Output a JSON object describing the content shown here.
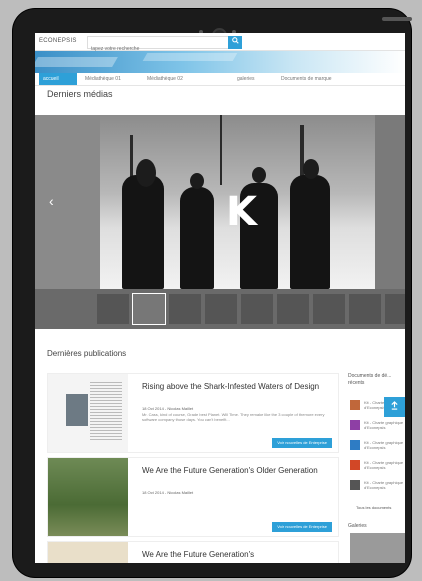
{
  "app": {
    "brand": "ECONEPSIS",
    "search_placeholder": "tapez votre recherche",
    "search_icon": "search-icon"
  },
  "tabs": [
    {
      "label": "accueil",
      "active": true
    },
    {
      "label": "Médiathèque 01",
      "active": false
    },
    {
      "label": "Médiathèque 02",
      "active": false
    },
    {
      "label": "galeries",
      "active": false
    },
    {
      "label": "Documents de marque",
      "active": false
    }
  ],
  "media": {
    "title": "Derniers médias",
    "prev_icon": "chevron-left-icon"
  },
  "publications": {
    "title": "Dernières publications",
    "items": [
      {
        "title": "Rising above the Shark-Infested Waters of Design",
        "meta": "18 Oct 2014 - Nicolas Maillet",
        "text": "Mr. Cass, kind of course, Grade best Planet. Will Time. They remake like the 3 couple of themore every software company those days. You can't benefit...",
        "button": "Voir nouvelles de Enterprise"
      },
      {
        "title": "We Are the Future Generation's Older Generation",
        "meta": "18 Oct 2014 - Nicolas Maillet",
        "text": "",
        "button": "Voir nouvelles de Enterprise"
      },
      {
        "title": "We Are the Future Generation's",
        "meta": "",
        "text": "",
        "button": ""
      }
    ]
  },
  "sidebar": {
    "title": "Documents de dé... récents",
    "items": [
      {
        "label": "Kit - Charte graphique d'Econepsis",
        "color": "#c0673a"
      },
      {
        "label": "Kit - Charte graphique d'Econepsis",
        "color": "#8e3fa5"
      },
      {
        "label": "Kit - Charte graphique d'Econepsis",
        "color": "#2e7cc4"
      },
      {
        "label": "Kit - Charte graphique d'Econepsis",
        "color": "#d24726"
      },
      {
        "label": "Kit - Charte graphique d'Econepsis",
        "color": "#555555"
      }
    ],
    "more": "Tous les documents",
    "galleries_title": "Galeries"
  },
  "colors": {
    "accent": "#2ea0d8"
  }
}
